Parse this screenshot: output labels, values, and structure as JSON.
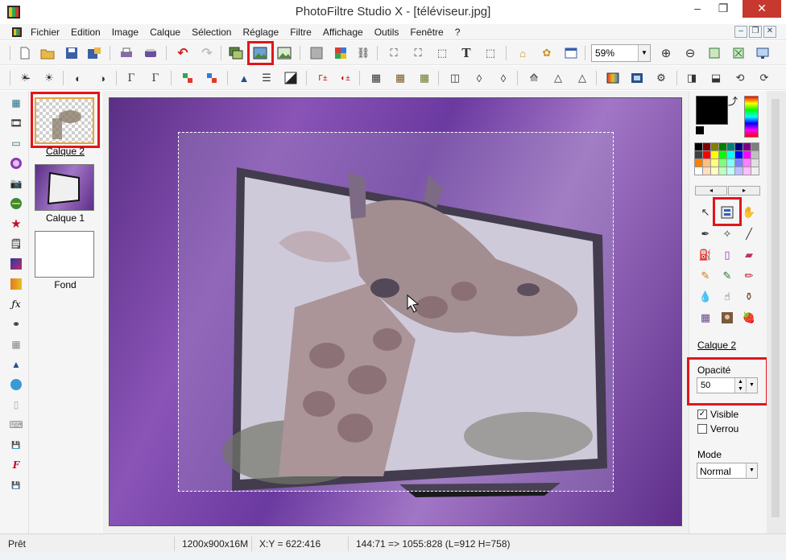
{
  "window": {
    "title": "PhotoFiltre Studio X - [téléviseur.jpg]",
    "minimize": "–",
    "maximize": "❐",
    "close": "✕"
  },
  "menu": {
    "items": [
      "Fichier",
      "Edition",
      "Image",
      "Calque",
      "Sélection",
      "Réglage",
      "Filtre",
      "Affichage",
      "Outils",
      "Fenêtre",
      "?"
    ]
  },
  "toolbar": {
    "zoom_value": "59%"
  },
  "layers": [
    {
      "label": "Calque 2",
      "active": true
    },
    {
      "label": "Calque 1",
      "active": false
    },
    {
      "label": "Fond",
      "active": false
    }
  ],
  "right_panel": {
    "layer_name": "Calque 2",
    "opacity_label": "Opacité",
    "opacity_value": "50",
    "visible_label": "Visible",
    "visible_checked": true,
    "lock_label": "Verrou",
    "lock_checked": false,
    "mode_label": "Mode",
    "mode_value": "Normal"
  },
  "status": {
    "state": "Prêt",
    "image_size": "1200x900x16M",
    "cursor": "X:Y = 622:416",
    "selection": "144:71 => 1055:828 (L=912  H=758)"
  },
  "colors": {
    "highlight_red": "#e0161b",
    "canvas_purple": "#7a47ad"
  }
}
